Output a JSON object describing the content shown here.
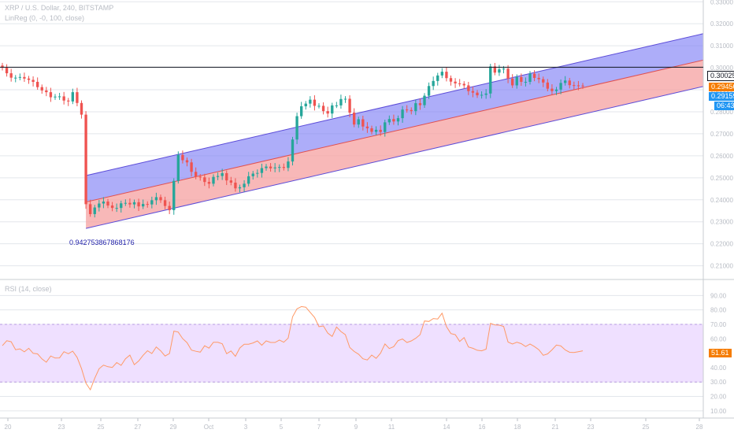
{
  "header": {
    "title": "XRP / U.S. Dollar, 240, BITSTAMP",
    "indicator": "LinReg (0, -0, 100, close)"
  },
  "rsi_panel": {
    "label": "RSI (14, close)"
  },
  "price_tags": {
    "line_price": "0.30025",
    "current": "0.29456",
    "last": "0.29159",
    "timer": "06:43",
    "rsi_value": "51.61"
  },
  "annotation": "0.942753867868176",
  "colors": {
    "up": "#26a69a",
    "down": "#ef5350",
    "upper_channel": "#7b7bf5",
    "lower_channel": "#f5a0a0",
    "channel_line": "#5b4bd8",
    "rsi_line": "#ff9966",
    "rsi_band": "#efe0ff"
  },
  "chart_data": [
    {
      "type": "candlestick",
      "title": "XRP / U.S. Dollar, 240, BITSTAMP",
      "x_tick_labels": [
        "20",
        "23",
        "25",
        "27",
        "29",
        "Oct",
        "3",
        "5",
        "7",
        "9",
        "11",
        "14",
        "16",
        "18",
        "21",
        "23",
        "25",
        "28"
      ],
      "y_tick_labels": [
        "0.21000",
        "0.22000",
        "0.23000",
        "0.24000",
        "0.25000",
        "0.26000",
        "0.27000",
        "0.28000",
        "0.29000",
        "0.30000",
        "0.31000",
        "0.32000",
        "0.33000"
      ],
      "ylim": [
        0.2045,
        0.3308
      ],
      "close_series": [
        0.3,
        0.2975,
        0.2955,
        0.2955,
        0.2958,
        0.2951,
        0.2945,
        0.2936,
        0.2912,
        0.2897,
        0.2889,
        0.2866,
        0.2869,
        0.287,
        0.2851,
        0.2847,
        0.2889,
        0.284,
        0.2787,
        0.238,
        0.2335,
        0.2365,
        0.2383,
        0.2392,
        0.2374,
        0.2363,
        0.2363,
        0.2384,
        0.2386,
        0.2379,
        0.2389,
        0.237,
        0.2381,
        0.2379,
        0.2398,
        0.2412,
        0.2398,
        0.2372,
        0.2353,
        0.2486,
        0.2604,
        0.258,
        0.257,
        0.2527,
        0.2505,
        0.2502,
        0.2481,
        0.2473,
        0.2504,
        0.2508,
        0.2521,
        0.2488,
        0.2478,
        0.2452,
        0.2457,
        0.2473,
        0.2507,
        0.2519,
        0.2522,
        0.2544,
        0.2551,
        0.2543,
        0.2547,
        0.2549,
        0.2545,
        0.2574,
        0.2674,
        0.278,
        0.2825,
        0.2837,
        0.2855,
        0.2827,
        0.2827,
        0.2803,
        0.2792,
        0.2829,
        0.2829,
        0.2858,
        0.2859,
        0.2796,
        0.2742,
        0.2766,
        0.2733,
        0.2725,
        0.2709,
        0.2718,
        0.2708,
        0.2752,
        0.2767,
        0.2756,
        0.2771,
        0.281,
        0.2808,
        0.2803,
        0.2839,
        0.283,
        0.2873,
        0.2917,
        0.294,
        0.2965,
        0.2982,
        0.2953,
        0.2937,
        0.2929,
        0.2927,
        0.292,
        0.2894,
        0.2887,
        0.2875,
        0.2877,
        0.2883,
        0.3006,
        0.2978,
        0.2993,
        0.2996,
        0.2951,
        0.292,
        0.2958,
        0.2936,
        0.2936,
        0.2973,
        0.2954,
        0.2948,
        0.2933,
        0.2905,
        0.2894,
        0.2901,
        0.2931,
        0.2942,
        0.2921,
        0.292,
        0.2919,
        0.2916
      ],
      "linear_regression_channel": {
        "start_center": 0.239,
        "end_center": 0.303,
        "band_offset": 0.012,
        "pearson_r": "0.942753867868176"
      },
      "horizontal_line": 0.30025
    },
    {
      "type": "line",
      "title": "RSI (14, close)",
      "y_tick_labels": [
        "10.00",
        "20.00",
        "30.00",
        "40.00",
        "50.00",
        "60.00",
        "70.00",
        "80.00",
        "90.00"
      ],
      "ylim": [
        5,
        100
      ],
      "band": [
        30,
        70
      ],
      "values": [
        55.2,
        58.6,
        57.9,
        52.4,
        53.0,
        50.9,
        53.4,
        49.9,
        49.5,
        46.0,
        43.7,
        48.0,
        46.6,
        46.7,
        51.0,
        49.6,
        51.4,
        47.1,
        39.3,
        29.2,
        24.6,
        32.6,
        39.2,
        41.7,
        40.6,
        40.1,
        43.5,
        41.5,
        46.1,
        48.6,
        42.0,
        44.6,
        48.5,
        51.7,
        49.7,
        54.3,
        51.6,
        48.0,
        49.7,
        65.3,
        64.6,
        60.1,
        57.3,
        52.1,
        51.3,
        50.7,
        55.1,
        53.5,
        57.6,
        57.5,
        56.5,
        49.6,
        51.5,
        47.8,
        53.6,
        56.2,
        56.2,
        57.1,
        58.5,
        55.5,
        58.5,
        57.4,
        57.4,
        59.1,
        57.6,
        60.4,
        75.2,
        80.7,
        82.3,
        81.9,
        78.3,
        74.8,
        68.4,
        68.9,
        63.9,
        61.6,
        68.1,
        65.0,
        62.8,
        53.9,
        51.2,
        49.3,
        46.1,
        45.3,
        48.7,
        46.4,
        50.0,
        56.4,
        53.2,
        54.5,
        58.7,
        59.8,
        57.4,
        58.5,
        60.3,
        62.8,
        72.3,
        72.0,
        74.0,
        73.7,
        77.7,
        68.4,
        63.6,
        62.8,
        58.1,
        60.8,
        54.3,
        53.4,
        52.0,
        51.6,
        52.8,
        70.7,
        69.6,
        69.4,
        68.5,
        57.7,
        56.3,
        57.6,
        56.6,
        54.6,
        56.4,
        54.6,
        52.4,
        48.5,
        49.5,
        52.3,
        55.6,
        55.0,
        52.2,
        50.6,
        50.4,
        51.0,
        51.6
      ]
    }
  ]
}
